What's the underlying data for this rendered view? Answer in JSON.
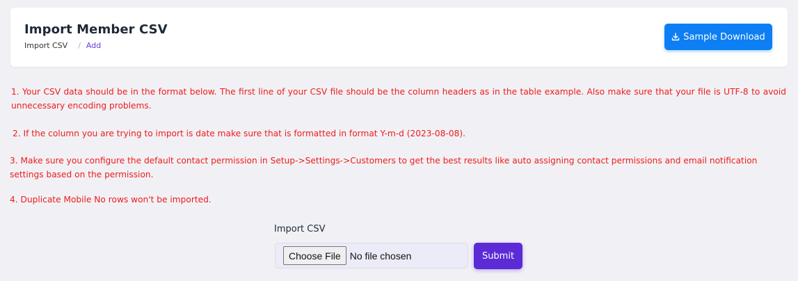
{
  "header": {
    "title": "Import Member CSV",
    "breadcrumb": [
      {
        "label": "Import CSV"
      },
      {
        "label": "Add"
      }
    ],
    "breadcrumb_separator": "/",
    "sample_download_label": "Sample Download",
    "sample_download_icon": "download-icon"
  },
  "instructions": [
    "1. Your CSV data should be in the format below. The first line of your CSV file should be the column headers as in the table example. Also make sure that your file is UTF-8 to avoid unnecessary encoding problems.",
    "2. If the column you are trying to import is date make sure that is formatted in format Y-m-d (2023-08-08).",
    "3. Make sure you configure the default contact permission in Setup->Settings->Customers to get the best results like auto assigning contact permissions and email notification settings based on the permission.",
    "4. Duplicate Mobile No rows won't be imported."
  ],
  "form": {
    "import_label": "Import CSV",
    "choose_file_label": "Choose File",
    "file_status": "No file chosen",
    "submit_label": "Submit"
  },
  "colors": {
    "background": "#f1f1f5",
    "primary_blue": "#0d7ef3",
    "primary_purple": "#5b2bd6",
    "warning_red": "#ee1c1c",
    "breadcrumb_active": "#6a3bd8"
  }
}
